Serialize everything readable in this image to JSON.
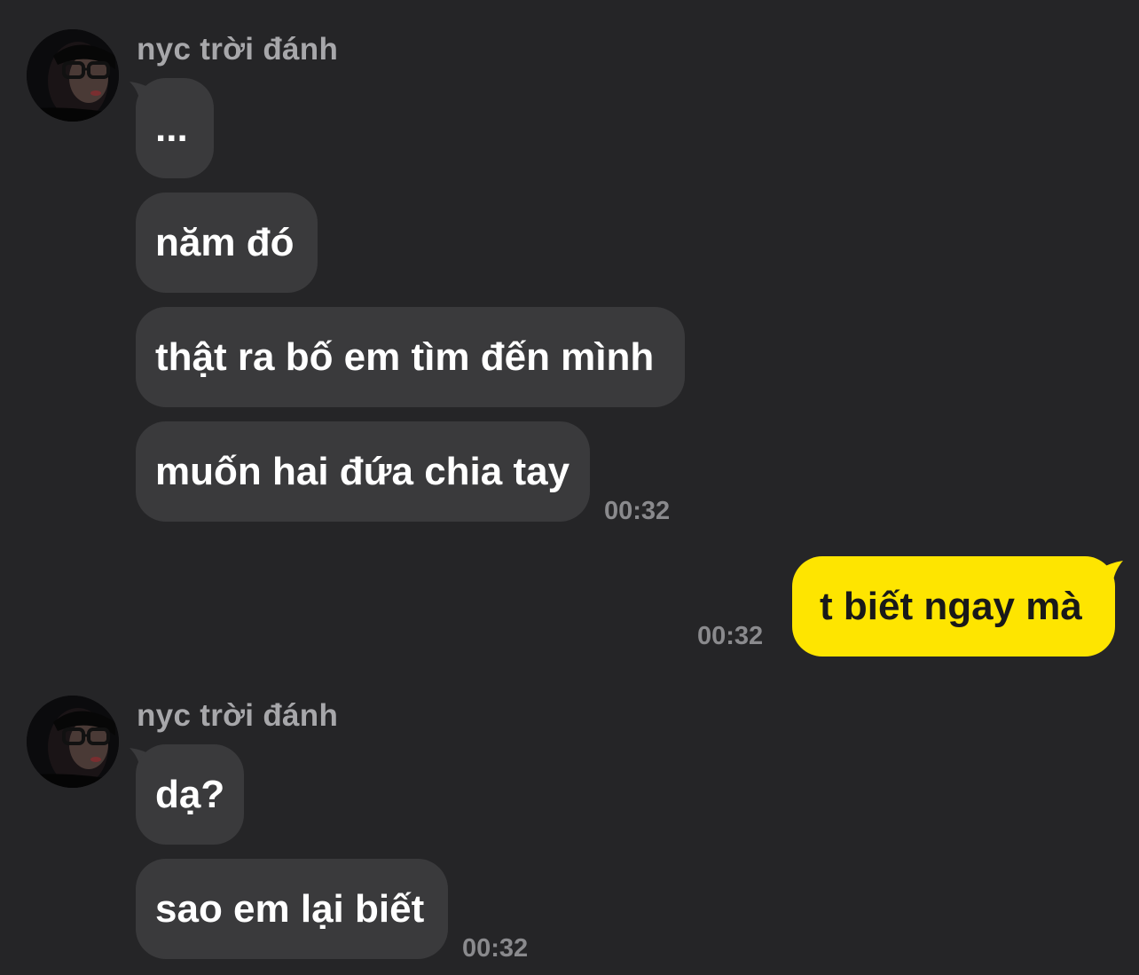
{
  "chat": {
    "groups": [
      {
        "sender": "nyc trời đánh",
        "messages": [
          "...",
          "năm đó",
          "thật ra bố em tìm đến mình",
          "muốn hai đứa chia tay"
        ],
        "time": "00:32"
      },
      {
        "outgoing": true,
        "messages": [
          "t biết ngay mà"
        ],
        "time": "00:32"
      },
      {
        "sender": "nyc trời đánh",
        "messages": [
          "dạ?",
          "sao em lại biết"
        ],
        "time": "00:32"
      }
    ]
  },
  "colors": {
    "background": "#252527",
    "incoming_bubble": "#3a3a3c",
    "outgoing_bubble": "#fee500",
    "sender_name": "#a7a7aa",
    "timestamp": "#8a8a8d"
  }
}
